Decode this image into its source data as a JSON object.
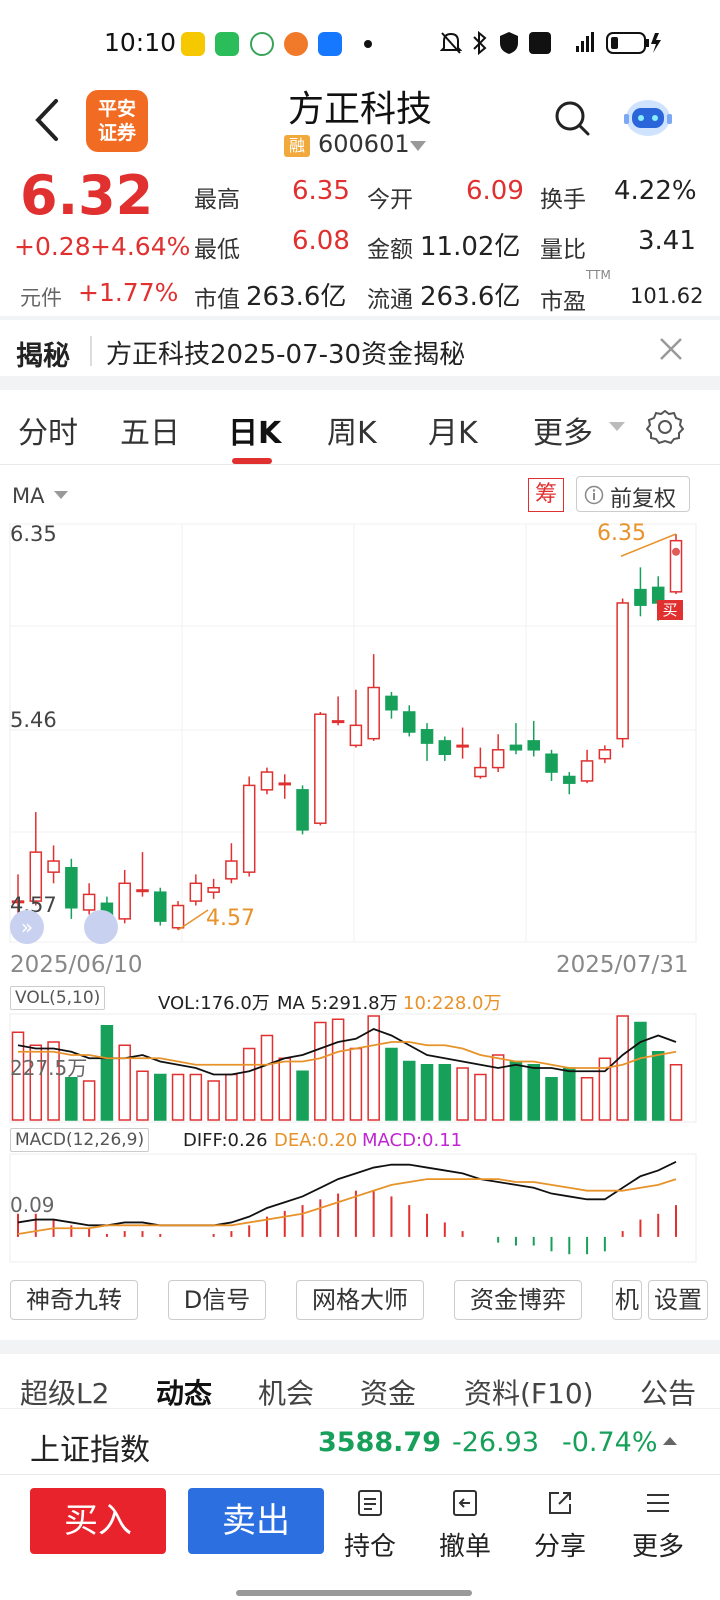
{
  "status_bar": {
    "time": "10:10",
    "battery": "",
    "network": "4G"
  },
  "header": {
    "title": "方正科技",
    "rong_badge": "融",
    "code": "600601",
    "logo_text_1": "平安",
    "logo_text_2": "证券"
  },
  "quote": {
    "price": "6.32",
    "change": "+0.28",
    "change_pct": "+4.64%",
    "unit_label": "元件",
    "unit_change": "+1.77%",
    "high_label": "最高",
    "high": "6.35",
    "open_label": "今开",
    "open": "6.09",
    "turnover_label": "换手",
    "turnover": "4.22%",
    "low_label": "最低",
    "low": "6.08",
    "amount_label": "金额",
    "amount": "11.02亿",
    "vol_ratio_label": "量比",
    "vol_ratio": "3.41",
    "mktcap_label": "市值",
    "mktcap": "263.6亿",
    "float_label": "流通",
    "float": "263.6亿",
    "pe_label": "市盈",
    "pe_sup": "TTM",
    "pe": "101.62"
  },
  "secret": {
    "title": "揭秘",
    "text": "方正科技2025-07-30资金揭秘"
  },
  "tabs": [
    "分时",
    "五日",
    "日K",
    "周K",
    "月K",
    "更多"
  ],
  "chart": {
    "ma_label": "MA",
    "chou": "筹",
    "fuquan": "前复权",
    "high_label": "6.35",
    "mid_label": "5.46",
    "low_label": "4.57",
    "high_marker": "6.35",
    "low_marker": "4.57",
    "buy_marker": "买",
    "start_date": "2025/06/10",
    "end_date": "2025/07/31",
    "vol_box": "VOL(5,10)",
    "vol_text": "VOL:176.0万",
    "vol_ma5": "MA 5:291.8万",
    "vol_ma10": "10:228.0万",
    "vol_axis": "227.5万",
    "macd_box": "MACD(12,26,9)",
    "diff": "DIFF:0.26",
    "dea": "DEA:0.20",
    "macd": "MACD:0.11",
    "macd_axis": "0.09"
  },
  "chart_data": {
    "type": "candlestick",
    "x_start": "2025/06/10",
    "x_end": "2025/07/31",
    "ylim": [
      4.57,
      6.35
    ],
    "candles": [
      {
        "o": 4.7,
        "c": 4.7,
        "h": 4.82,
        "l": 4.6
      },
      {
        "o": 4.7,
        "c": 4.92,
        "h": 5.1,
        "l": 4.68
      },
      {
        "o": 4.83,
        "c": 4.88,
        "h": 4.95,
        "l": 4.78
      },
      {
        "o": 4.85,
        "c": 4.67,
        "h": 4.89,
        "l": 4.62
      },
      {
        "o": 4.66,
        "c": 4.73,
        "h": 4.78,
        "l": 4.64
      },
      {
        "o": 4.69,
        "c": 4.62,
        "h": 4.72,
        "l": 4.57
      },
      {
        "o": 4.62,
        "c": 4.78,
        "h": 4.84,
        "l": 4.6
      },
      {
        "o": 4.75,
        "c": 4.75,
        "h": 4.92,
        "l": 4.72
      },
      {
        "o": 4.74,
        "c": 4.61,
        "h": 4.76,
        "l": 4.59
      },
      {
        "o": 4.58,
        "c": 4.68,
        "h": 4.7,
        "l": 4.57
      },
      {
        "o": 4.7,
        "c": 4.78,
        "h": 4.82,
        "l": 4.68
      },
      {
        "o": 4.74,
        "c": 4.76,
        "h": 4.8,
        "l": 4.71
      },
      {
        "o": 4.8,
        "c": 4.88,
        "h": 4.96,
        "l": 4.78
      },
      {
        "o": 4.83,
        "c": 5.22,
        "h": 5.26,
        "l": 4.81
      },
      {
        "o": 5.2,
        "c": 5.28,
        "h": 5.3,
        "l": 5.18
      },
      {
        "o": 5.23,
        "c": 5.23,
        "h": 5.27,
        "l": 5.16
      },
      {
        "o": 5.2,
        "c": 5.02,
        "h": 5.22,
        "l": 5.0
      },
      {
        "o": 5.05,
        "c": 5.54,
        "h": 5.55,
        "l": 5.04
      },
      {
        "o": 5.51,
        "c": 5.51,
        "h": 5.62,
        "l": 5.49
      },
      {
        "o": 5.4,
        "c": 5.49,
        "h": 5.65,
        "l": 5.39
      },
      {
        "o": 5.43,
        "c": 5.66,
        "h": 5.81,
        "l": 5.42
      },
      {
        "o": 5.62,
        "c": 5.56,
        "h": 5.64,
        "l": 5.52
      },
      {
        "o": 5.55,
        "c": 5.46,
        "h": 5.58,
        "l": 5.44
      },
      {
        "o": 5.47,
        "c": 5.41,
        "h": 5.5,
        "l": 5.33
      },
      {
        "o": 5.42,
        "c": 5.36,
        "h": 5.44,
        "l": 5.33
      },
      {
        "o": 5.4,
        "c": 5.4,
        "h": 5.48,
        "l": 5.34
      },
      {
        "o": 5.26,
        "c": 5.3,
        "h": 5.39,
        "l": 5.25
      },
      {
        "o": 5.3,
        "c": 5.38,
        "h": 5.45,
        "l": 5.28
      },
      {
        "o": 5.4,
        "c": 5.38,
        "h": 5.5,
        "l": 5.36
      },
      {
        "o": 5.42,
        "c": 5.38,
        "h": 5.51,
        "l": 5.35
      },
      {
        "o": 5.36,
        "c": 5.28,
        "h": 5.38,
        "l": 5.24
      },
      {
        "o": 5.26,
        "c": 5.23,
        "h": 5.28,
        "l": 5.18
      },
      {
        "o": 5.24,
        "c": 5.33,
        "h": 5.38,
        "l": 5.23
      },
      {
        "o": 5.34,
        "c": 5.38,
        "h": 5.4,
        "l": 5.32
      },
      {
        "o": 5.43,
        "c": 6.04,
        "h": 6.06,
        "l": 5.39
      },
      {
        "o": 6.1,
        "c": 6.03,
        "h": 6.2,
        "l": 5.98
      },
      {
        "o": 6.11,
        "c": 6.04,
        "h": 6.16,
        "l": 5.96
      },
      {
        "o": 6.09,
        "c": 6.32,
        "h": 6.35,
        "l": 6.08
      }
    ],
    "ma_high_line": [
      6.25,
      6.35
    ],
    "ma_low_line": [
      4.57,
      4.66
    ],
    "volume": [
      2.7,
      2.3,
      2.4,
      1.3,
      1.2,
      2.9,
      2.3,
      1.5,
      1.4,
      1.4,
      1.4,
      1.2,
      1.4,
      2.2,
      2.6,
      1.9,
      1.5,
      3.0,
      3.1,
      2.2,
      3.2,
      2.2,
      1.8,
      1.7,
      1.7,
      1.6,
      1.4,
      2.0,
      1.8,
      1.7,
      1.3,
      1.6,
      1.3,
      1.9,
      3.2,
      3.0,
      2.1,
      1.7
    ],
    "vol_ma5": [
      2.3,
      2.2,
      2.2,
      2.1,
      1.9,
      1.9,
      1.9,
      2.0,
      1.8,
      1.7,
      1.6,
      1.4,
      1.4,
      1.5,
      1.7,
      1.9,
      2.0,
      2.2,
      2.4,
      2.5,
      2.8,
      2.6,
      2.3,
      2.0,
      1.9,
      1.8,
      1.7,
      1.6,
      1.7,
      1.6,
      1.6,
      1.5,
      1.5,
      1.5,
      2.0,
      2.4,
      2.6,
      2.4
    ],
    "vol_ma10": [
      2.1,
      2.1,
      2.1,
      2.0,
      2.0,
      1.9,
      1.9,
      1.9,
      1.9,
      1.8,
      1.7,
      1.7,
      1.7,
      1.7,
      1.7,
      1.8,
      1.8,
      1.9,
      2.1,
      2.2,
      2.3,
      2.4,
      2.4,
      2.3,
      2.3,
      2.2,
      2.0,
      1.9,
      1.8,
      1.8,
      1.7,
      1.6,
      1.6,
      1.6,
      1.7,
      1.9,
      2.0,
      2.1
    ],
    "diff": [
      0.05,
      0.06,
      0.06,
      0.05,
      0.04,
      0.04,
      0.05,
      0.05,
      0.04,
      0.04,
      0.04,
      0.04,
      0.05,
      0.07,
      0.1,
      0.12,
      0.14,
      0.17,
      0.2,
      0.22,
      0.24,
      0.25,
      0.25,
      0.24,
      0.23,
      0.22,
      0.2,
      0.19,
      0.18,
      0.17,
      0.15,
      0.14,
      0.13,
      0.13,
      0.17,
      0.21,
      0.23,
      0.26
    ],
    "dea": [
      0.01,
      0.02,
      0.03,
      0.03,
      0.03,
      0.04,
      0.04,
      0.04,
      0.04,
      0.04,
      0.04,
      0.04,
      0.04,
      0.05,
      0.06,
      0.07,
      0.08,
      0.1,
      0.12,
      0.14,
      0.16,
      0.18,
      0.19,
      0.2,
      0.2,
      0.2,
      0.2,
      0.2,
      0.19,
      0.19,
      0.18,
      0.17,
      0.16,
      0.16,
      0.16,
      0.17,
      0.18,
      0.2
    ],
    "macd": [
      0.08,
      0.08,
      0.06,
      0.04,
      0.03,
      0.01,
      0.02,
      0.02,
      0.01,
      0.0,
      0.0,
      0.01,
      0.02,
      0.04,
      0.07,
      0.09,
      0.11,
      0.13,
      0.15,
      0.16,
      0.16,
      0.14,
      0.11,
      0.08,
      0.05,
      0.02,
      0.0,
      -0.02,
      -0.03,
      -0.03,
      -0.05,
      -0.06,
      -0.06,
      -0.05,
      0.02,
      0.06,
      0.08,
      0.11
    ]
  },
  "tool_buttons": [
    "神奇九转",
    "D信号",
    "网格大师",
    "资金博弈",
    "机",
    "设置"
  ],
  "sub_tabs": [
    "超级L2",
    "动态",
    "机会",
    "资金",
    "资料(F10)",
    "公告"
  ],
  "index_bar": {
    "name": "上证指数",
    "value": "3588.79",
    "change": "-26.93",
    "pct": "-0.74%"
  },
  "bottom": {
    "buy": "买入",
    "sell": "卖出",
    "position": "持仓",
    "cancel": "撤单",
    "share": "分享",
    "more": "更多"
  },
  "colors": {
    "up": "#e03030",
    "down": "#16a05a",
    "ma_orange": "#e8922a",
    "macd_purple": "#c026d3"
  }
}
